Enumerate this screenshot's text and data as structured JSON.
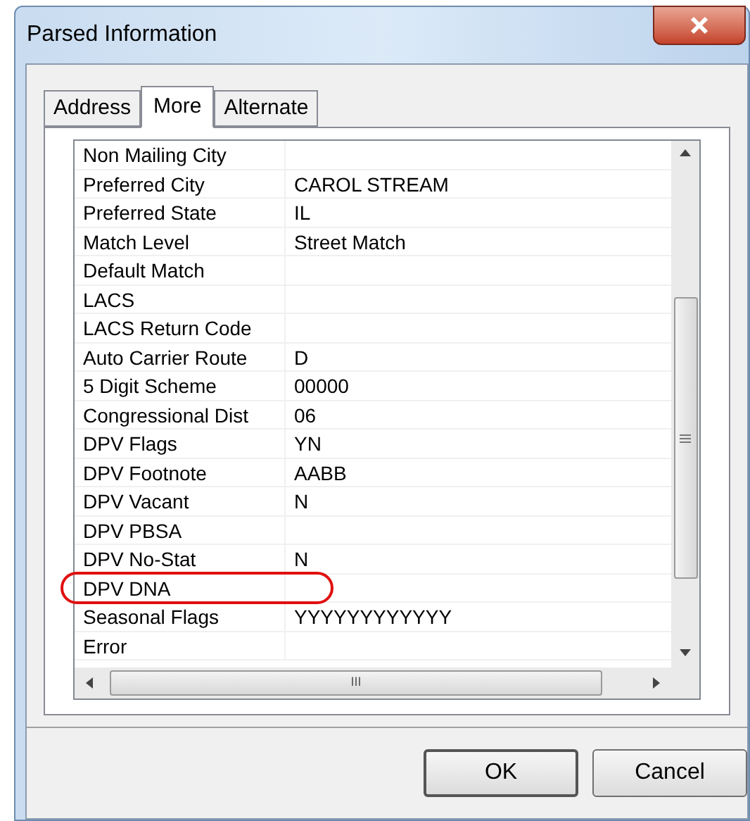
{
  "window": {
    "title": "Parsed Information"
  },
  "tabs": [
    {
      "label": "Address",
      "selected": false
    },
    {
      "label": "More",
      "selected": true
    },
    {
      "label": "Alternate",
      "selected": false
    }
  ],
  "rows": [
    {
      "name": "Non Mailing City",
      "highlighted": false
    },
    {
      "name": "Preferred City",
      "value": "CAROL STREAM",
      "highlighted": false
    },
    {
      "name": "Preferred State",
      "value": "IL",
      "highlighted": false
    },
    {
      "name": "Match Level",
      "value": "Street Match",
      "highlighted": false
    },
    {
      "name": "Default Match",
      "highlighted": false
    },
    {
      "name": "LACS",
      "highlighted": false
    },
    {
      "name": "LACS Return Code",
      "highlighted": false
    },
    {
      "name": "Auto Carrier Route",
      "value": "D",
      "highlighted": false
    },
    {
      "name": "5 Digit Scheme",
      "value": "00000",
      "highlighted": false
    },
    {
      "name": "Congressional Dist",
      "value": "06",
      "highlighted": false
    },
    {
      "name": "DPV Flags",
      "value": "YN",
      "highlighted": false
    },
    {
      "name": "DPV Footnote",
      "value": "AABB",
      "highlighted": false
    },
    {
      "name": "DPV Vacant",
      "value": "N",
      "highlighted": false
    },
    {
      "name": "DPV PBSA",
      "highlighted": false
    },
    {
      "name": "DPV No-Stat",
      "value": "N",
      "highlighted": false
    },
    {
      "name": "DPV DNA",
      "highlighted": true
    },
    {
      "name": "Seasonal Flags",
      "value": "YYYYYYYYYYYY",
      "highlighted": false
    },
    {
      "name": "Error",
      "highlighted": false
    }
  ],
  "horizontal_scroll_grip": "III",
  "buttons": [
    "OK",
    "Cancel"
  ]
}
